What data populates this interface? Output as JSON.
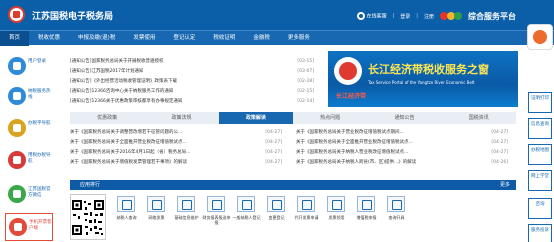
{
  "header": {
    "site_title": "江苏国税电子税务局",
    "online_consult": "在线客服",
    "login": "登录",
    "register": "注册",
    "service_platform": "综合服务平台"
  },
  "nav": [
    "首页",
    "税收优惠",
    "申报及缴(退)税",
    "发票使用",
    "登记认定",
    "税收证明",
    "金融税",
    "更多服务"
  ],
  "left_items": [
    {
      "label": "用户登录",
      "color": "#2f8ad8"
    },
    {
      "label": "纳税服务热线",
      "color": "#2f8ad8"
    },
    {
      "label": "办税平导航",
      "color": "#d8a41e"
    },
    {
      "label": "用税办税导航",
      "color": "#d83a3a"
    },
    {
      "label": "江苏国税官方微信",
      "color": "#3aa84a"
    },
    {
      "label": "手机开票客户端",
      "color": "#e24a3a"
    }
  ],
  "announcements": [
    {
      "tag": "[通知公告]",
      "title": "国家税务总局关于开展税收普遍授权",
      "date": "[03-15]"
    },
    {
      "tag": "[通知公告]",
      "title": "江苏国税2017年计划通知",
      "date": "[03-07]"
    },
    {
      "tag": "[通知公告]",
      "title": "《外出经营活动税收管理证明》政策表下载",
      "date": "[02-28]"
    },
    {
      "tag": "[通知公告]",
      "title": "12366咨询中心关于纳税服务工作的通知",
      "date": "[02-15]"
    },
    {
      "tag": "[通知公告]",
      "title": "12366关于优惠政策审核都享有办事规定通知",
      "date": "[02-14]"
    }
  ],
  "banner": {
    "big": "长江经济带税收服务之窗",
    "sub": "Tax Service Portal of the Yangtze River Economic Belt",
    "slogan": "长江经济带"
  },
  "tabs": [
    "优惠政策",
    "政策法规",
    "政策解读",
    "热点问题",
    "通知公告",
    "国税资讯"
  ],
  "policy_left": [
    {
      "title": "关于《国家税务总局关于调整营改增若干征管问题的公...",
      "date": "[04-27]"
    },
    {
      "title": "关于《国家税务总局关于全面推开营业税改征增值税试点...",
      "date": "[04-27]"
    },
    {
      "title": "关于《国家税务总局关于2016年4月1日起（省）税务总局...",
      "date": "[04-27]"
    },
    {
      "title": "关于《国家税务总局关于增值税发票管理若干事项》的解读",
      "date": "[04-27]"
    }
  ],
  "policy_right": [
    {
      "title": "关于《国家税务总局关于营业税改征增值税试点期间...",
      "date": "[04-27]"
    },
    {
      "title": "关于《国家税务总局关于全面推开营业税改征增值税试点...",
      "date": "[04-27]"
    },
    {
      "title": "关于《国家税务总局关于纳税人营业税改征增值税试点...",
      "date": "[04-27]"
    },
    {
      "title": "关于《国家税务总局关于纳税人跨县(市、区)提供...》的解读",
      "date": "[04-26]"
    }
  ],
  "app_section": {
    "title": "应用排行",
    "more": "更多"
  },
  "apps": [
    "纳税人查询",
    "网络发票",
    "基础信息维护",
    "财务报表报送申报",
    "一般纳税人登记",
    "变更登记",
    "代开发票申请",
    "发票领用",
    "增值税申报",
    "查询开具"
  ],
  "right_items": [
    "证明打印",
    "信息查询",
    "办税地图",
    "网上学堂",
    "咨询",
    "服务投诉"
  ]
}
